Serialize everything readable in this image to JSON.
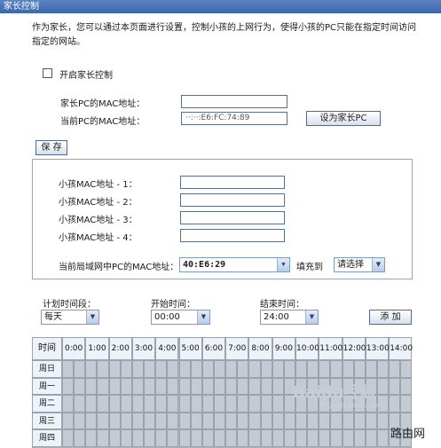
{
  "window": {
    "title": "家长控制"
  },
  "description": "作为家长，您可以通过本页面进行设置，控制小孩的上网行为，使得小孩的PC只能在指定时间访问指定的网站。",
  "enable": {
    "label": "开启家长控制",
    "checked": false
  },
  "parent_mac": {
    "label": "家长PC的MAC地址：",
    "current_label": "当前PC的MAC地址：",
    "current_value": "··:··:E6:FC:74:89",
    "set_button": "设为家长PC"
  },
  "save_button": "保 存",
  "child_macs": {
    "labels": [
      "小孩MAC地址 - 1：",
      "小孩MAC地址 - 2：",
      "小孩MAC地址 - 3：",
      "小孩MAC地址 - 4："
    ],
    "lan_label": "当前局域网中PC的MAC地址：",
    "lan_value": "40:E6:29",
    "fill_label": "填充到",
    "fill_select": "请选择"
  },
  "schedule": {
    "period_label": "计划时间段：",
    "period_value": "每天",
    "start_label": "开始时间：",
    "start_value": "00:00",
    "end_label": "结束时间：",
    "end_value": "24:00",
    "add_button": "添 加"
  },
  "grid": {
    "corner": "时间",
    "hours": [
      "0:00",
      "1:00",
      "2:00",
      "3:00",
      "4:00",
      "5:00",
      "6:00",
      "7:00",
      "8:00",
      "9:00",
      "10:00",
      "11:00",
      "12:00",
      "13:00",
      "14:00"
    ],
    "days": [
      "周日",
      "周一",
      "周二",
      "周三",
      "周四"
    ]
  },
  "icons": {
    "dropdown": "chevron-down-icon",
    "checkbox": "checkbox-icon"
  },
  "watermark": {
    "brand": "Baidu经验",
    "url": "jingyan.baidu.com",
    "site": "路由网"
  }
}
